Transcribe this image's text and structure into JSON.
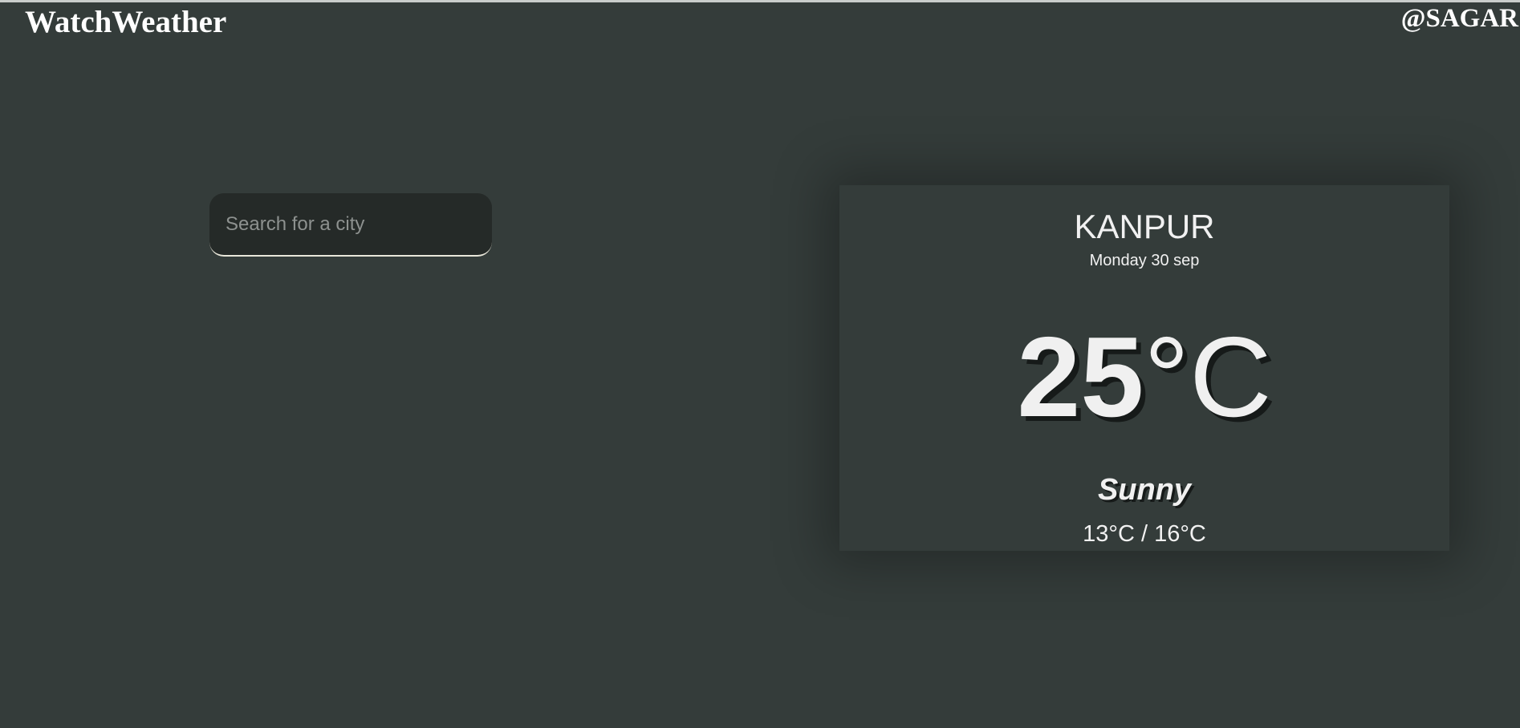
{
  "app": {
    "brand": "WatchWeather",
    "handle": "@SAGAR"
  },
  "search": {
    "placeholder": "Search for a city",
    "value": ""
  },
  "weather": {
    "city": "KANPUR",
    "date": "Monday 30 sep",
    "temperature_value": "25",
    "temperature_unit": "°C",
    "condition": "Sunny",
    "range": "13°C / 16°C"
  },
  "colors": {
    "background": "#343c3a",
    "input_background": "#252a28",
    "text": "#ffffff"
  }
}
